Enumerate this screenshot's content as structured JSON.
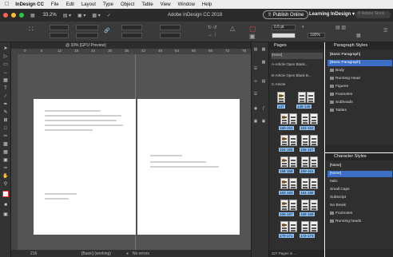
{
  "menubar": {
    "items": [
      "InDesign CC",
      "File",
      "Edit",
      "Layout",
      "Type",
      "Object",
      "Table",
      "View",
      "Window",
      "Help"
    ]
  },
  "appbar": {
    "zoom": "33.2%",
    "title": "Adobe InDesign CC 2018",
    "publish_label": "Publish Online",
    "workspace": "Learning InDesign",
    "search_placeholder": "Adobe Stock"
  },
  "control": {
    "stroke_weight": "0.5 pt",
    "opacity": "100%"
  },
  "document": {
    "tab_title": "@ 33% [GPU Preview]",
    "ruler_ticks": [
      "0",
      "6",
      "12",
      "18",
      "24",
      "30",
      "36",
      "42",
      "48",
      "54",
      "60",
      "66",
      "72",
      "78"
    ],
    "status_page": "216",
    "status_style": "[Basic] (working)",
    "status_errors": "No errors"
  },
  "pages_panel": {
    "title": "Pages",
    "masters": [
      "[None]",
      "A-Article Open Blank...",
      "B-Article Open Blank B...",
      "C-Article"
    ],
    "spreads": [
      {
        "left": "147",
        "right": "148-149"
      },
      {
        "left": "150-151",
        "right": "152-153"
      },
      {
        "left": "154-155",
        "right": "156-157"
      },
      {
        "left": "158-159",
        "right": "160-161"
      },
      {
        "left": "162-163",
        "right": "164-165"
      },
      {
        "left": "166-167",
        "right": "168-169"
      },
      {
        "left": "170-171",
        "right": "172-173"
      }
    ],
    "footer": "327 Pages in ..."
  },
  "paragraph_styles": {
    "title": "Paragraph Styles",
    "current": "[Basic Paragraph]",
    "items": [
      {
        "label": "[Basic Paragraph]",
        "selected": true,
        "group": false
      },
      {
        "label": "Body",
        "selected": false,
        "group": true
      },
      {
        "label": "Running Head",
        "selected": false,
        "group": true
      },
      {
        "label": "Figures",
        "selected": false,
        "group": true
      },
      {
        "label": "Footnotes",
        "selected": false,
        "group": true
      },
      {
        "label": "Subheads",
        "selected": false,
        "group": true
      },
      {
        "label": "Tables",
        "selected": false,
        "group": true
      }
    ]
  },
  "character_styles": {
    "title": "Character Styles",
    "current": "[None]",
    "items": [
      {
        "label": "[None]",
        "selected": true,
        "group": false
      },
      {
        "label": "Italic",
        "selected": false,
        "group": false
      },
      {
        "label": "Small Caps",
        "selected": false,
        "group": false
      },
      {
        "label": "Subscript",
        "selected": false,
        "group": false
      },
      {
        "label": "No Break",
        "selected": false,
        "group": false
      },
      {
        "label": "Footnotes",
        "selected": false,
        "group": true
      },
      {
        "label": "Running heads",
        "selected": false,
        "group": true
      }
    ]
  },
  "colors": {
    "accent": "#3c6ec7",
    "page_label": "#8cc4ff",
    "close": "#ff5f57",
    "minimize": "#febc2e",
    "zoom": "#28c840"
  }
}
